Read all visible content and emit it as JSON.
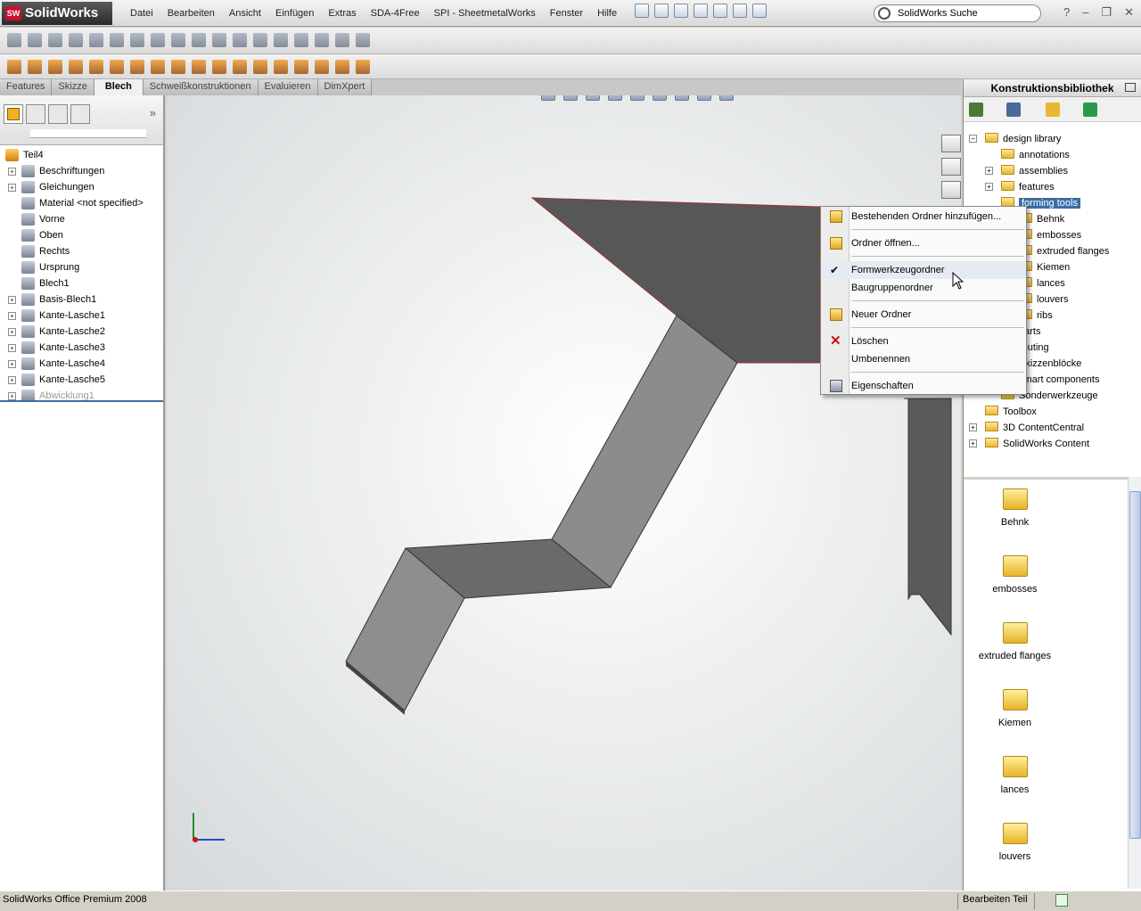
{
  "app": {
    "logo": "SolidWorks",
    "logo_badge": "SW"
  },
  "menu": [
    "Datei",
    "Bearbeiten",
    "Ansicht",
    "Einfügen",
    "Extras",
    "SDA-4Free",
    "SPI - SheetmetalWorks",
    "Fenster",
    "Hilfe"
  ],
  "search": {
    "placeholder": "SolidWorks Suche"
  },
  "window_controls": {
    "help": "?",
    "minimize": "–",
    "restore": "❐",
    "close": "✕"
  },
  "command_tabs": [
    "Features",
    "Skizze",
    "Blech",
    "Schweißkonstruktionen",
    "Evaluieren",
    "DimXpert"
  ],
  "active_tab": "Blech",
  "feature_tree": [
    {
      "label": "Teil4",
      "root": true
    },
    {
      "label": "Beschriftungen",
      "expand": true
    },
    {
      "label": "Gleichungen",
      "expand": true
    },
    {
      "label": "Material <not specified>",
      "expand": false
    },
    {
      "label": "Vorne",
      "expand": false
    },
    {
      "label": "Oben",
      "expand": false
    },
    {
      "label": "Rechts",
      "expand": false
    },
    {
      "label": "Ursprung",
      "expand": false
    },
    {
      "label": "Blech1",
      "expand": false
    },
    {
      "label": "Basis-Blech1",
      "expand": true
    },
    {
      "label": "Kante-Lasche1",
      "expand": true
    },
    {
      "label": "Kante-Lasche2",
      "expand": true
    },
    {
      "label": "Kante-Lasche3",
      "expand": true
    },
    {
      "label": "Kante-Lasche4",
      "expand": true
    },
    {
      "label": "Kante-Lasche5",
      "expand": true
    },
    {
      "label": "Abwicklung1",
      "expand": true,
      "dim": true
    }
  ],
  "design_library": {
    "title": "Konstruktionsbibliothek",
    "tree": [
      {
        "label": "design library",
        "level": 0,
        "exp": "−"
      },
      {
        "label": "annotations",
        "level": 1
      },
      {
        "label": "assemblies",
        "level": 1,
        "exp": "+"
      },
      {
        "label": "features",
        "level": 1,
        "exp": "+"
      },
      {
        "label": "forming tools",
        "level": 1,
        "selected": true
      },
      {
        "label": "Behnk",
        "level": 2
      },
      {
        "label": "embosses",
        "level": 2
      },
      {
        "label": "extruded flanges",
        "level": 2
      },
      {
        "label": "Kiemen",
        "level": 2
      },
      {
        "label": "lances",
        "level": 2
      },
      {
        "label": "louvers",
        "level": 2
      },
      {
        "label": "ribs",
        "level": 2
      },
      {
        "label": "parts",
        "level": 1
      },
      {
        "label": "routing",
        "level": 1
      },
      {
        "label": "Skizzenblöcke",
        "level": 1
      },
      {
        "label": "smart components",
        "level": 1
      },
      {
        "label": "Sonderwerkzeuge",
        "level": 1
      },
      {
        "label": "Toolbox",
        "level": 0
      },
      {
        "label": "3D ContentCentral",
        "level": 0,
        "exp": "+"
      },
      {
        "label": "SolidWorks Content",
        "level": 0,
        "exp": "+"
      }
    ],
    "folders": [
      "Behnk",
      "embosses",
      "extruded flanges",
      "Kiemen",
      "lances",
      "louvers"
    ]
  },
  "context_menu": {
    "items": [
      {
        "label": "Bestehenden Ordner hinzufügen...",
        "icon": "add-folder-icon"
      },
      {
        "label": "Ordner öffnen...",
        "icon": "open-folder-icon"
      },
      {
        "label": "Formwerkzeugordner",
        "icon": "checkmark-icon",
        "checked": true
      },
      {
        "label": "Baugruppenordner"
      },
      {
        "label": "Neuer Ordner",
        "icon": "new-folder-icon"
      },
      {
        "label": "Löschen",
        "icon": "delete-icon"
      },
      {
        "label": "Umbenennen"
      },
      {
        "label": "Eigenschaften",
        "icon": "properties-icon"
      }
    ]
  },
  "status": {
    "left": "SolidWorks Office Premium 2008",
    "right": "Bearbeiten Teil"
  },
  "colors": {
    "selection": "#3a6ea5",
    "delete_red": "#d01010",
    "model_dark": "#575757",
    "model_mid": "#8c8c8c"
  }
}
